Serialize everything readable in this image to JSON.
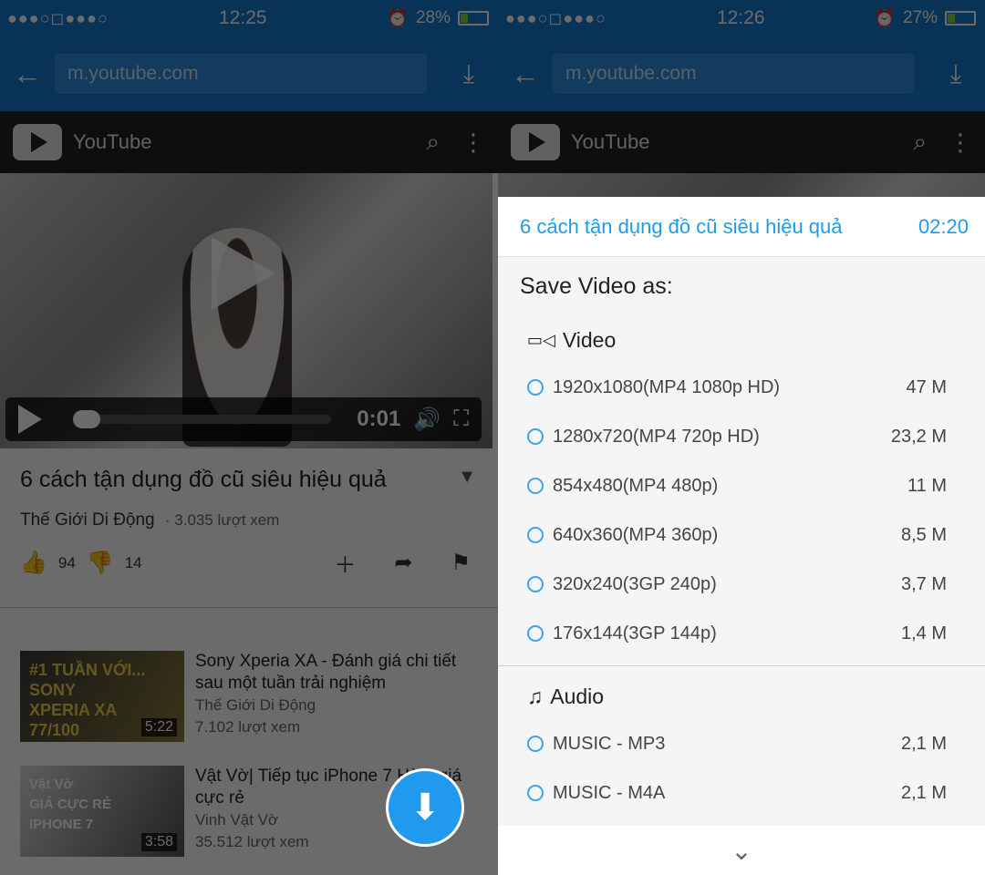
{
  "left": {
    "status": {
      "signal": "●●●○◻●●●○",
      "time": "12:25",
      "battery": "28%"
    },
    "browser": {
      "url": "m.youtube.com"
    },
    "youtube": {
      "brand": "YouTube"
    },
    "player": {
      "time": "0:01"
    },
    "video": {
      "title": "6 cách tận dụng đồ cũ siêu hiệu quả",
      "channel": "Thế Giới Di Động",
      "views": "· 3.035 lượt xem",
      "likes": "94",
      "dislikes": "14"
    },
    "related": [
      {
        "thumb_text": "#1 TUẦN VỚI...\nSONY\nXPERIA XA\n77/100",
        "duration": "5:22",
        "title": "Sony Xperia XA - Đánh giá chi tiết sau một tuần trải nghiệm",
        "channel": "Thế Giới Di Động",
        "views": "7.102 lượt xem"
      },
      {
        "thumb_text": "Vật Vờ\nGIÁ CỰC RẺ\nIPHONE 7",
        "duration": "3:58",
        "title": "Vật Vờ| Tiếp tục iPhone 7 Hà... giá cực rẻ",
        "channel": "Vinh Vật Vờ",
        "views": "35.512 lượt xem"
      }
    ]
  },
  "right": {
    "status": {
      "signal": "●●●○◻●●●○",
      "time": "12:26",
      "battery": "27%"
    },
    "browser": {
      "url": "m.youtube.com"
    },
    "youtube": {
      "brand": "YouTube"
    },
    "dialog": {
      "title": "6 cách tận dụng đồ cũ siêu hiệu quả",
      "duration": "02:20",
      "save_as": "Save Video as:",
      "video_heading": "Video",
      "video_options": [
        {
          "label": "1920x1080(MP4 1080p HD)",
          "size": "47 M"
        },
        {
          "label": "1280x720(MP4 720p HD)",
          "size": "23,2 M"
        },
        {
          "label": "854x480(MP4 480p)",
          "size": "11 M"
        },
        {
          "label": "640x360(MP4 360p)",
          "size": "8,5 M"
        },
        {
          "label": "320x240(3GP 240p)",
          "size": "3,7 M"
        },
        {
          "label": "176x144(3GP 144p)",
          "size": "1,4 M"
        }
      ],
      "audio_heading": "Audio",
      "audio_options": [
        {
          "label": "MUSIC - MP3",
          "size": "2,1 M"
        },
        {
          "label": "MUSIC - M4A",
          "size": "2,1 M"
        }
      ]
    }
  }
}
